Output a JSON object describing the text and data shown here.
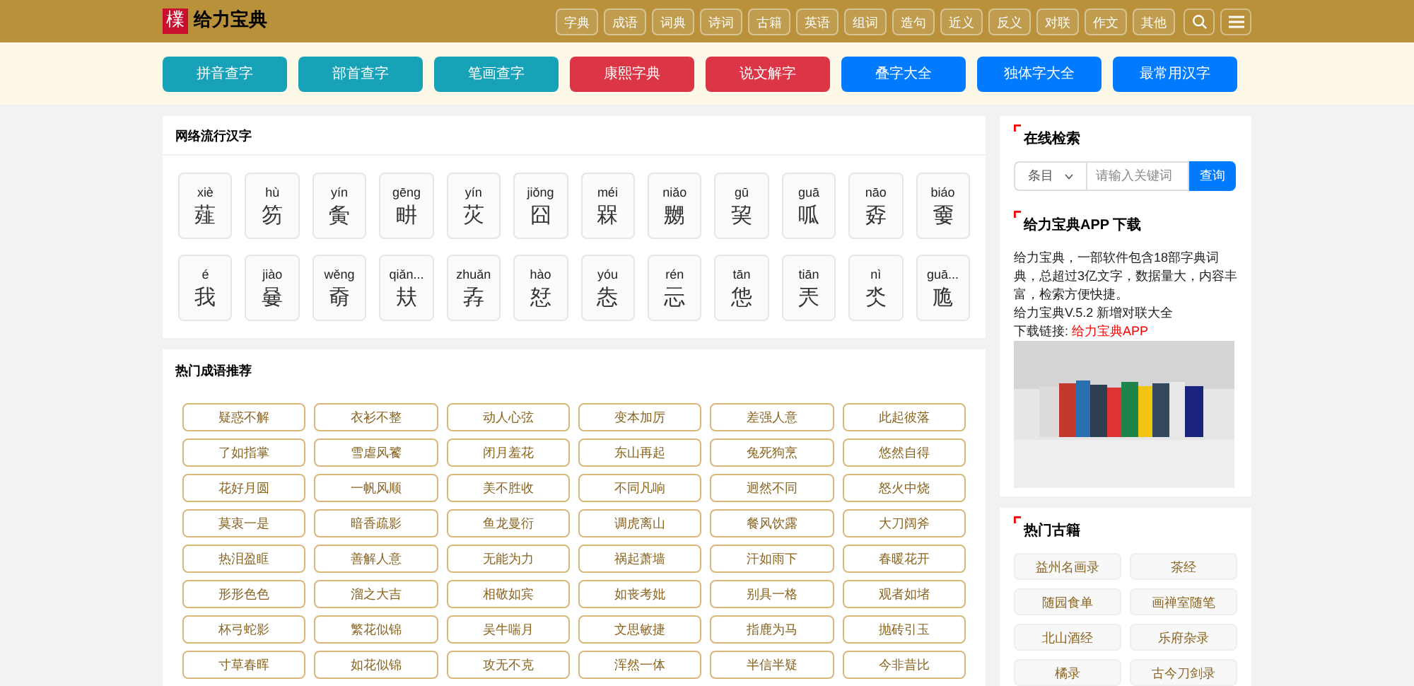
{
  "header": {
    "logo_mark": "檏",
    "logo_text": "给力宝典",
    "nav": [
      "字典",
      "成语",
      "词典",
      "诗词",
      "古籍",
      "英语",
      "组词",
      "造句",
      "近义",
      "反义",
      "对联",
      "作文",
      "其他"
    ]
  },
  "quick_links": [
    {
      "label": "拼音查字",
      "color": "#17a2b8"
    },
    {
      "label": "部首查字",
      "color": "#17a2b8"
    },
    {
      "label": "笔画查字",
      "color": "#17a2b8"
    },
    {
      "label": "康熙字典",
      "color": "#dc3545"
    },
    {
      "label": "说文解字",
      "color": "#dc3545"
    },
    {
      "label": "叠字大全",
      "color": "#007bff"
    },
    {
      "label": "独体字大全",
      "color": "#007bff"
    },
    {
      "label": "最常用汉字",
      "color": "#007bff"
    }
  ],
  "popular_chars": {
    "title": "网络流行汉字",
    "items": [
      {
        "pinyin": "xiè",
        "char": "薤"
      },
      {
        "pinyin": "hù",
        "char": "笏"
      },
      {
        "pinyin": "yín",
        "char": "夤"
      },
      {
        "pinyin": "gēng",
        "char": "畊"
      },
      {
        "pinyin": "yín",
        "char": "苂"
      },
      {
        "pinyin": "jiǒng",
        "char": "囧"
      },
      {
        "pinyin": "méi",
        "char": "槑"
      },
      {
        "pinyin": "niǎo",
        "char": "嬲"
      },
      {
        "pinyin": "gū",
        "char": "巭"
      },
      {
        "pinyin": "guā",
        "char": "呱"
      },
      {
        "pinyin": "nāo",
        "char": "孬"
      },
      {
        "pinyin": "biáo",
        "char": "嫑"
      },
      {
        "pinyin": "é",
        "char": "我"
      },
      {
        "pinyin": "jiào",
        "char": "嘦"
      },
      {
        "pinyin": "wěng",
        "char": "奣"
      },
      {
        "pinyin": "qiǎn...",
        "char": "㚘"
      },
      {
        "pinyin": "zhuǎn",
        "char": "孨"
      },
      {
        "pinyin": "hào",
        "char": "恏"
      },
      {
        "pinyin": "yóu",
        "char": "怣"
      },
      {
        "pinyin": "rén",
        "char": "忈"
      },
      {
        "pinyin": "tān",
        "char": "怹"
      },
      {
        "pinyin": "tiān",
        "char": "兲"
      },
      {
        "pinyin": "nì",
        "char": "氼"
      },
      {
        "pinyin": "guā...",
        "char": "卼"
      }
    ]
  },
  "idioms": {
    "title": "热门成语推荐",
    "items": [
      "疑惑不解",
      "衣衫不整",
      "动人心弦",
      "变本加厉",
      "差强人意",
      "此起彼落",
      "了如指掌",
      "雪虐风饕",
      "闭月羞花",
      "东山再起",
      "兔死狗烹",
      "悠然自得",
      "花好月圆",
      "一帆风顺",
      "美不胜收",
      "不同凡响",
      "迥然不同",
      "怒火中烧",
      "莫衷一是",
      "暗香疏影",
      "鱼龙曼衍",
      "调虎离山",
      "餐风饮露",
      "大刀阔斧",
      "热泪盈眶",
      "善解人意",
      "无能为力",
      "祸起萧墙",
      "汗如雨下",
      "春暖花开",
      "形形色色",
      "溜之大吉",
      "相敬如宾",
      "如丧考妣",
      "别具一格",
      "观者如堵",
      "杯弓蛇影",
      "繁花似锦",
      "吴牛喘月",
      "文思敏捷",
      "指鹿为马",
      "抛砖引玉",
      "寸草春晖",
      "如花似锦",
      "攻无不克",
      "浑然一体",
      "半信半疑",
      "今非昔比"
    ]
  },
  "search": {
    "title": "在线检索",
    "select": "条目",
    "placeholder": "请输入关键词",
    "button": "查询"
  },
  "app": {
    "title": "给力宝典APP 下载",
    "description": "给力宝典，一部软件包含18部字典词典，总超过3亿文字，数据量大，内容丰富，检索方便快捷。",
    "update": "给力宝典V.5.2 新增对联大全",
    "link_label": "下载链接:",
    "link": "给力宝典APP"
  },
  "classics": {
    "title": "热门古籍",
    "items": [
      "益州名画录",
      "茶经",
      "随园食单",
      "画禅室随笔",
      "北山酒经",
      "乐府杂录",
      "橘录",
      "古今刀剑录"
    ]
  }
}
